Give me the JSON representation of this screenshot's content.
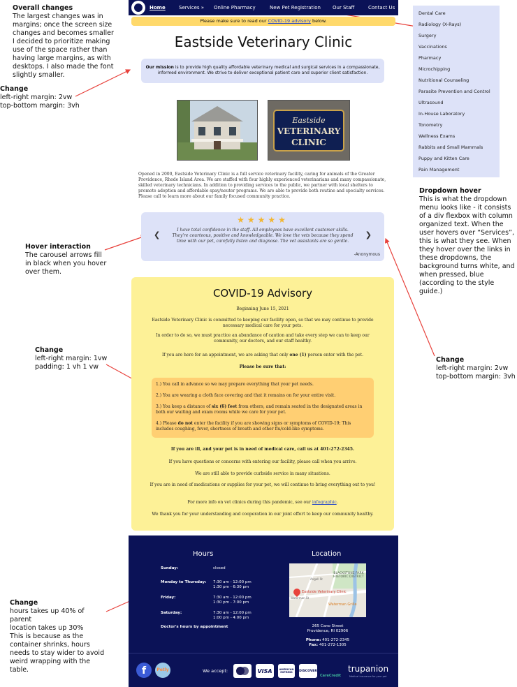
{
  "annotations": {
    "overall_title": "Overall changes",
    "overall_text": "The largest changes was in margins; once the screen size changes and becomes smaller I decided to prioritize making use of the space rather than having large margins, as with desktops. I also made the font slightly smaller.",
    "change1_title": "Change",
    "change1_line1": "left-right margin: 2vw",
    "change1_line2": "top-bottom margin: 3vh",
    "hover_title": "Hover interaction",
    "hover_text": "The carousel arrows fill in black when you hover over them.",
    "change2_title": "Change",
    "change2_line1": "left-right margin: 1vw",
    "change2_line2": "padding: 1 vh 1 vw",
    "change3_title": "Change",
    "change3_line1": "hours takes up 40% of parent",
    "change3_line2": "location takes up 30%",
    "change3_text": "This is because as the container shrinks, hours needs to stay wider to avoid weird wrapping with the table.",
    "dropdown_title": "Dropdown hover",
    "dropdown_text": "This is what the dropdown menu looks like - it consists of a div flexbox with column organized text. When the user hovers over “Services”, this is what they see. When they hover over the links in these dropdowns, the background turns white, and when pressed, blue (according to the style guide.)",
    "change4_title": "Change",
    "change4_line1": "left-right margin: 2vw",
    "change4_line2": "top-bottom margin: 3vh"
  },
  "nav": {
    "home": "Home",
    "services": "Services »",
    "pharmacy": "Online Pharmacy",
    "registration": "New Pet Registration",
    "staff": "Our Staff",
    "contact": "Contact Us"
  },
  "banner": {
    "prefix": "Please make sure to read our ",
    "link": "COVID-19 advisory",
    "suffix": " below."
  },
  "title": "Eastside Veterinary Clinic",
  "mission": {
    "label": "Our mission",
    "text": " is to provide high quality affordable veterinary medical and surgical services in a compassionate, informed environment. We strive to deliver exceptional patient care and superior client satisfaction."
  },
  "sign_text": "Eastside VETERINARY CLINIC",
  "about": "Opened in 2000, Eastside Veterinary Clinic is a full service veterinary facility, caring for animals of the Greater Providence, Rhode Island Area. We are staffed with four highly experienced veterinarians and many compassionate, skilled veterinary technicians. In addition to providing services to the public, we partner with local shelters to promote adoption and affordable spay/neuter programs. We are able to provide both routine and specialty services. Please call to learn more about our family focused community practice.",
  "review": {
    "stars": "★★★★★",
    "rating": 5,
    "quote": "I have total confidence in the staff. All employees have excellent customer skills. They're courteous, positive and knowledgeable. We love the vets because they spend time with our pet, carefully listen and diagnose. The vet assistants are so gentle.",
    "author": "-Anonymous"
  },
  "covid": {
    "title": "COVID-19 Advisory",
    "date": "Beginning June 15, 2021",
    "p1": "Eastside Veterinary Clinic is committed to keeping our facility open, so that we may continue to provide necessary medical care for your pets.",
    "p2": "In order to do so, we must practice an abundance of caution and take every step we can to keep our community, our doctors, and our staff healthy.",
    "p3a": "If you are here for an appointment, we are asking that only ",
    "p3b": "one (1)",
    "p3c": " person enter with the pet.",
    "sure": "Please be sure that:",
    "r1": "1.) You call in advance so we may prepare everything that your pet needs.",
    "r2": "2.) You are wearing a cloth face covering and that it remains on for your entire visit.",
    "r3a": "3.) You keep a distance of ",
    "r3b": "six (6) feet",
    "r3c": " from others, and remain seated in the designated areas in both our waiting and exam rooms while we care for your pet.",
    "r4a": "4.) Please ",
    "r4b": "do not",
    "r4c": " enter the facility if you are showing signs or symptoms of COVID-19; This includes coughing, fever, shortness of breath and other flu/cold-like symptoms.",
    "ill": "If you are ill, and your pet is in need of medical care, call us at 401-272-2345.",
    "q1": "If you have questions or concerns with entering our facility, please call when you arrive.",
    "q2": "We are still able to provide curbside service in many situations.",
    "meds": "If you are in need of medications or supplies for your pet, we will continue to bring everything out to you!",
    "more_a": "For more info on vet clinics during this pandemic, see our ",
    "more_link": "infographic",
    "more_c": ".",
    "thanks": "We thank you for your understanding and cooperation in our joint effort to keep our community healthy."
  },
  "footer": {
    "hours_title": "Hours",
    "location_title": "Location",
    "hours": [
      {
        "day": "Sunday:",
        "time1": "closed",
        "time2": ""
      },
      {
        "day": "Monday to Thursday:",
        "time1": "7:30 am - 12:00 pm",
        "time2": "1:30 pm - 6:30 pm"
      },
      {
        "day": "Friday:",
        "time1": "7:30 am - 12:00 pm",
        "time2": "1:30 pm - 7:00 pm"
      },
      {
        "day": "Saturday:",
        "time1": "7:30 am - 12:00 pm",
        "time2": "1:00 pm - 4:00 pm"
      }
    ],
    "doctor_note": "Doctor's hours by appointment",
    "map_labels": {
      "district": "BLACKSTONE PARK HISTORIC DISTRICT",
      "pin": "Eastside Veterinary Clinic",
      "place": "Waterman Grille",
      "street1": "Waterman St",
      "street2": "Angell St"
    },
    "address1": "265 Cano Street",
    "address2": "Providence, RI 02906",
    "phone_label": "Phone:",
    "phone": "401-272-2345",
    "fax_label": "Fax:",
    "fax": "401-272-1305",
    "accept": "We accept:",
    "petly": "Petly",
    "cards": {
      "mastercard": "mastercard",
      "visa": "VISA",
      "amex": "AMERICAN EXPRESS",
      "discover": "DISCOVER",
      "carecredit": "CareCredit",
      "trupanion": "trupanion",
      "trupanion_tag": "Medical insurance for your pet"
    }
  },
  "dropdown": [
    "Dental Care",
    "Radiology (X-Rays)",
    "Surgery",
    "Vaccinations",
    "Pharmacy",
    "Microchipping",
    "Nutritional Counseling",
    "Parasite Prevention and Control",
    "Ultrasound",
    "In-House Laboratory",
    "Tonometry",
    "Wellness Exams",
    "Rabbits and Small Mammals",
    "Puppy and Kitten Care",
    "Pain Management"
  ],
  "colors": {
    "navy": "#0b1257",
    "lavender": "#dde2f8",
    "yellow": "#fdf197",
    "orange": "#ffcf73",
    "annotation_arrow": "#e8423c"
  }
}
